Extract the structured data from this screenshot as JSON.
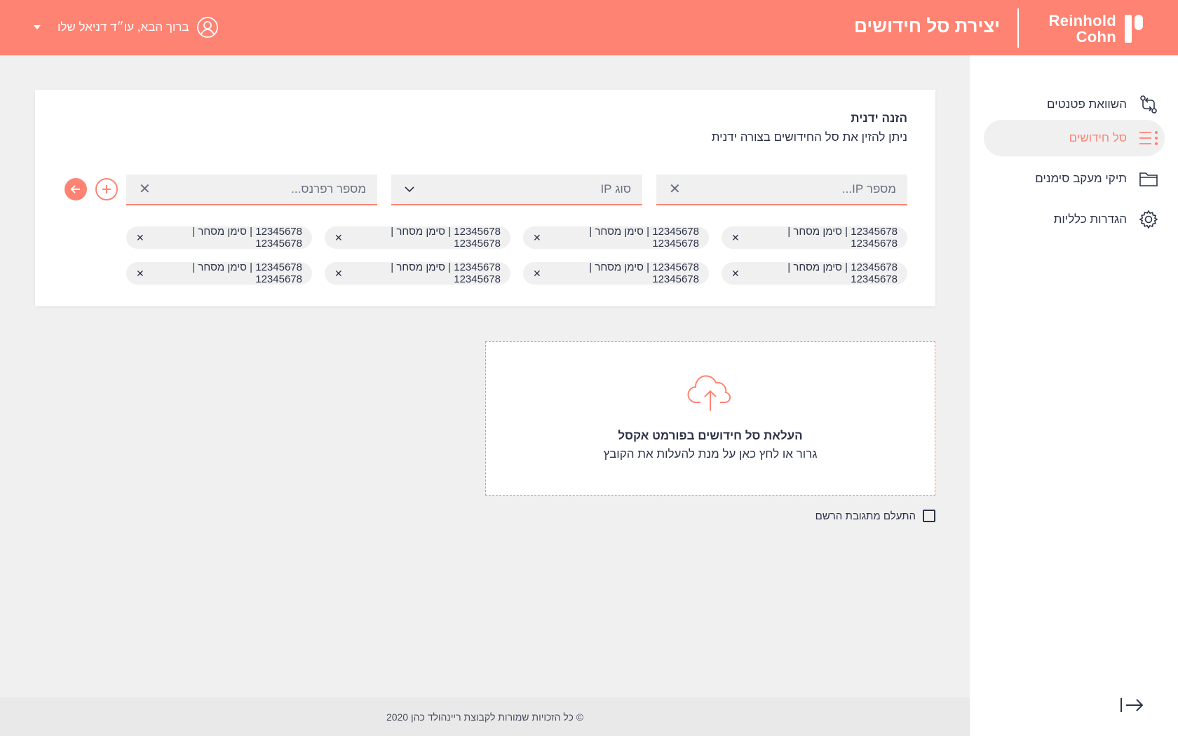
{
  "header": {
    "logo_line1": "Reinhold",
    "logo_line2": "Cohn",
    "title": "יצירת סל חידושים",
    "user_greeting": "ברוך הבא, עו״ד דניאל שלו"
  },
  "sidebar": {
    "items": [
      {
        "label": "השוואת פטנטים",
        "icon": "compare-icon"
      },
      {
        "label": "סל חידושים",
        "icon": "list-icon",
        "active": true
      },
      {
        "label": "תיקי מעקב סימנים",
        "icon": "folder-icon"
      },
      {
        "label": "הגדרות כלליות",
        "icon": "gear-icon"
      }
    ]
  },
  "manual": {
    "title": "הזנה ידנית",
    "subtitle": "ניתן להזין את סל החידושים בצורה ידנית",
    "ip_number_placeholder": "מספר IP...",
    "ip_type_placeholder": "סוג IP",
    "reference_placeholder": "מספר רפרנס..."
  },
  "chips": [
    "12345678 | סימן מסחר | 12345678",
    "12345678 | סימן מסחר | 12345678",
    "12345678 | סימן מסחר | 12345678",
    "12345678 | סימן מסחר | 12345678",
    "12345678 | סימן מסחר | 12345678",
    "12345678 | סימן מסחר | 12345678",
    "12345678 | סימן מסחר | 12345678",
    "12345678 | סימן מסחר | 12345678"
  ],
  "upload": {
    "title": "העלאת סל חידושים בפורמט אקסל",
    "subtitle": "גרור או לחץ כאן על מנת להעלות את הקובץ"
  },
  "checkbox": {
    "label": "התעלם מתגובת הרשם",
    "checked": false
  },
  "footer": {
    "text": "© כל הזכויות שמורות לקבוצת ריינהולד כהן 2020"
  },
  "colors": {
    "accent": "#ff8373",
    "text": "#2c3348",
    "background": "#f0f0f0"
  }
}
